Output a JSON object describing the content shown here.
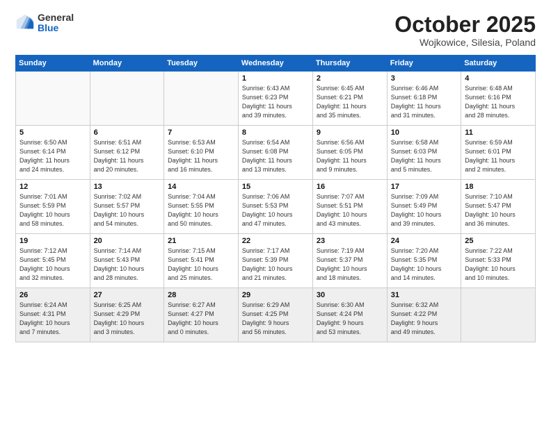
{
  "logo": {
    "general": "General",
    "blue": "Blue"
  },
  "header": {
    "title": "October 2025",
    "subtitle": "Wojkowice, Silesia, Poland"
  },
  "weekdays": [
    "Sunday",
    "Monday",
    "Tuesday",
    "Wednesday",
    "Thursday",
    "Friday",
    "Saturday"
  ],
  "weeks": [
    [
      {
        "day": "",
        "info": ""
      },
      {
        "day": "",
        "info": ""
      },
      {
        "day": "",
        "info": ""
      },
      {
        "day": "1",
        "info": "Sunrise: 6:43 AM\nSunset: 6:23 PM\nDaylight: 11 hours\nand 39 minutes."
      },
      {
        "day": "2",
        "info": "Sunrise: 6:45 AM\nSunset: 6:21 PM\nDaylight: 11 hours\nand 35 minutes."
      },
      {
        "day": "3",
        "info": "Sunrise: 6:46 AM\nSunset: 6:18 PM\nDaylight: 11 hours\nand 31 minutes."
      },
      {
        "day": "4",
        "info": "Sunrise: 6:48 AM\nSunset: 6:16 PM\nDaylight: 11 hours\nand 28 minutes."
      }
    ],
    [
      {
        "day": "5",
        "info": "Sunrise: 6:50 AM\nSunset: 6:14 PM\nDaylight: 11 hours\nand 24 minutes."
      },
      {
        "day": "6",
        "info": "Sunrise: 6:51 AM\nSunset: 6:12 PM\nDaylight: 11 hours\nand 20 minutes."
      },
      {
        "day": "7",
        "info": "Sunrise: 6:53 AM\nSunset: 6:10 PM\nDaylight: 11 hours\nand 16 minutes."
      },
      {
        "day": "8",
        "info": "Sunrise: 6:54 AM\nSunset: 6:08 PM\nDaylight: 11 hours\nand 13 minutes."
      },
      {
        "day": "9",
        "info": "Sunrise: 6:56 AM\nSunset: 6:05 PM\nDaylight: 11 hours\nand 9 minutes."
      },
      {
        "day": "10",
        "info": "Sunrise: 6:58 AM\nSunset: 6:03 PM\nDaylight: 11 hours\nand 5 minutes."
      },
      {
        "day": "11",
        "info": "Sunrise: 6:59 AM\nSunset: 6:01 PM\nDaylight: 11 hours\nand 2 minutes."
      }
    ],
    [
      {
        "day": "12",
        "info": "Sunrise: 7:01 AM\nSunset: 5:59 PM\nDaylight: 10 hours\nand 58 minutes."
      },
      {
        "day": "13",
        "info": "Sunrise: 7:02 AM\nSunset: 5:57 PM\nDaylight: 10 hours\nand 54 minutes."
      },
      {
        "day": "14",
        "info": "Sunrise: 7:04 AM\nSunset: 5:55 PM\nDaylight: 10 hours\nand 50 minutes."
      },
      {
        "day": "15",
        "info": "Sunrise: 7:06 AM\nSunset: 5:53 PM\nDaylight: 10 hours\nand 47 minutes."
      },
      {
        "day": "16",
        "info": "Sunrise: 7:07 AM\nSunset: 5:51 PM\nDaylight: 10 hours\nand 43 minutes."
      },
      {
        "day": "17",
        "info": "Sunrise: 7:09 AM\nSunset: 5:49 PM\nDaylight: 10 hours\nand 39 minutes."
      },
      {
        "day": "18",
        "info": "Sunrise: 7:10 AM\nSunset: 5:47 PM\nDaylight: 10 hours\nand 36 minutes."
      }
    ],
    [
      {
        "day": "19",
        "info": "Sunrise: 7:12 AM\nSunset: 5:45 PM\nDaylight: 10 hours\nand 32 minutes."
      },
      {
        "day": "20",
        "info": "Sunrise: 7:14 AM\nSunset: 5:43 PM\nDaylight: 10 hours\nand 28 minutes."
      },
      {
        "day": "21",
        "info": "Sunrise: 7:15 AM\nSunset: 5:41 PM\nDaylight: 10 hours\nand 25 minutes."
      },
      {
        "day": "22",
        "info": "Sunrise: 7:17 AM\nSunset: 5:39 PM\nDaylight: 10 hours\nand 21 minutes."
      },
      {
        "day": "23",
        "info": "Sunrise: 7:19 AM\nSunset: 5:37 PM\nDaylight: 10 hours\nand 18 minutes."
      },
      {
        "day": "24",
        "info": "Sunrise: 7:20 AM\nSunset: 5:35 PM\nDaylight: 10 hours\nand 14 minutes."
      },
      {
        "day": "25",
        "info": "Sunrise: 7:22 AM\nSunset: 5:33 PM\nDaylight: 10 hours\nand 10 minutes."
      }
    ],
    [
      {
        "day": "26",
        "info": "Sunrise: 6:24 AM\nSunset: 4:31 PM\nDaylight: 10 hours\nand 7 minutes."
      },
      {
        "day": "27",
        "info": "Sunrise: 6:25 AM\nSunset: 4:29 PM\nDaylight: 10 hours\nand 3 minutes."
      },
      {
        "day": "28",
        "info": "Sunrise: 6:27 AM\nSunset: 4:27 PM\nDaylight: 10 hours\nand 0 minutes."
      },
      {
        "day": "29",
        "info": "Sunrise: 6:29 AM\nSunset: 4:25 PM\nDaylight: 9 hours\nand 56 minutes."
      },
      {
        "day": "30",
        "info": "Sunrise: 6:30 AM\nSunset: 4:24 PM\nDaylight: 9 hours\nand 53 minutes."
      },
      {
        "day": "31",
        "info": "Sunrise: 6:32 AM\nSunset: 4:22 PM\nDaylight: 9 hours\nand 49 minutes."
      },
      {
        "day": "",
        "info": ""
      }
    ]
  ]
}
